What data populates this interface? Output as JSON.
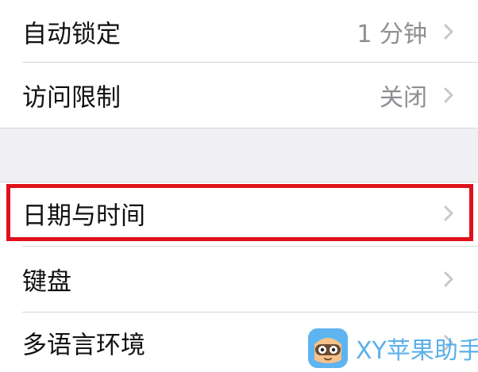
{
  "rows": [
    {
      "label": "自动锁定",
      "value": "1 分钟"
    },
    {
      "label": "访问限制",
      "value": "关闭"
    },
    {
      "label": "日期与时间",
      "value": ""
    },
    {
      "label": "键盘",
      "value": ""
    },
    {
      "label": "多语言环境",
      "value": ""
    }
  ],
  "watermark": {
    "text": "XY苹果助手"
  },
  "colors": {
    "highlight": "#e0111b",
    "group_background": "#efeff4",
    "secondary_text": "#8e8e93",
    "watermark_accent": "#4aa8e8"
  },
  "icons": {
    "disclosure": "chevron-right-icon",
    "watermark_logo": "xy-mascot-logo"
  }
}
